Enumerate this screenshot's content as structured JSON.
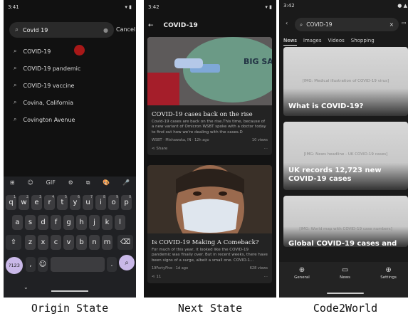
{
  "captions": [
    "Origin State",
    "Next State",
    "Code2World"
  ],
  "phone1": {
    "status_time": "3:41",
    "search_value": "Covid 19",
    "cancel_label": "Cancel",
    "suggestions": [
      "COVID-19",
      "COVID-19 pandemic",
      "COVID-19 vaccine",
      "Covina, California",
      "Covington Avenue"
    ],
    "kb_tools": [
      "⊞",
      "☺",
      "GIF",
      "⚙",
      "⧉",
      "🎨",
      "🎤"
    ],
    "row1": [
      "q",
      "w",
      "e",
      "r",
      "t",
      "y",
      "u",
      "i",
      "o",
      "p"
    ],
    "row1_nums": [
      "1",
      "2",
      "3",
      "4",
      "5",
      "6",
      "7",
      "8",
      "9",
      "0"
    ],
    "row2": [
      "a",
      "s",
      "d",
      "f",
      "g",
      "h",
      "j",
      "k",
      "l"
    ],
    "row3": [
      "z",
      "x",
      "c",
      "v",
      "b",
      "n",
      "m"
    ],
    "symbols_key": "?123",
    "comma_key": ",",
    "period_key": "."
  },
  "phone2": {
    "status_time": "3:42",
    "title": "COVID-19",
    "cards": [
      {
        "title": "COVID-19 cases back on the rise",
        "body": "Covid-19 cases are back on the rise.This time, because of a new variant of Omicron WSBT spoke with a doctor today to find out how we're dealing with the cases.D",
        "source": "WSBT · Mishawaka, IN · 12h ago",
        "views": "10 views",
        "share": "Share",
        "img_text": "BIG SAB"
      },
      {
        "title": "Is COVID-19 Making A Comeback?",
        "body": "For much of this year, it looked like the COVID-19 pandemic was finally over. But in recent weeks, there have been signs of a surge, albeit a small one. COVID-1...",
        "source": "19FortyFive · 1d ago",
        "views": "628 views",
        "share": "11"
      }
    ]
  },
  "phone3": {
    "status_time": "3:42",
    "search_value": "COVID-19",
    "tabs": [
      "News",
      "Images",
      "Videos",
      "Shopping"
    ],
    "cards": [
      {
        "placeholder": "[IMG: Medical illustration of COVID-19 virus]",
        "headline": "What is COVID-19?"
      },
      {
        "placeholder": "[IMG: News headline - UK COVID-19 cases]",
        "headline": "UK records 12,723 new COVID-19 cases"
      },
      {
        "placeholder": "[IMG: World map with COVID-19 case numbers]",
        "headline": "Global COVID-19 cases and"
      }
    ],
    "nav": [
      {
        "icon": "⊕",
        "label": "General"
      },
      {
        "icon": "▭",
        "label": "News"
      },
      {
        "icon": "⊕",
        "label": "Settings"
      }
    ]
  }
}
